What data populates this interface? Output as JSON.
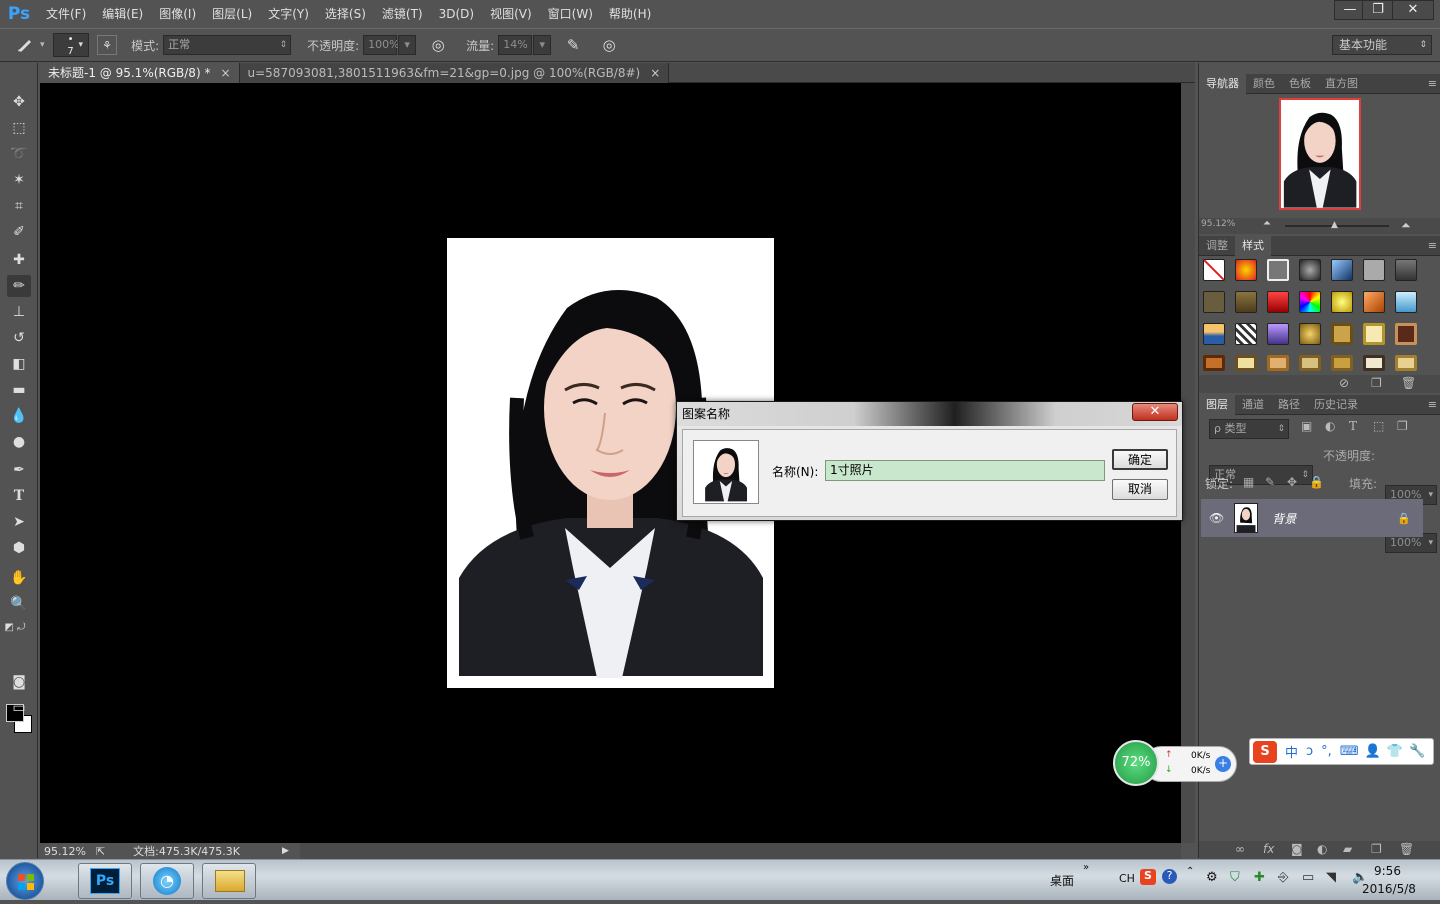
{
  "app": {
    "logo": "Ps"
  },
  "menu": [
    "文件(F)",
    "编辑(E)",
    "图像(I)",
    "图层(L)",
    "文字(Y)",
    "选择(S)",
    "滤镜(T)",
    "3D(D)",
    "视图(V)",
    "窗口(W)",
    "帮助(H)"
  ],
  "window_controls": {
    "minimize": "—",
    "restore": "❐",
    "close": "✕"
  },
  "options": {
    "brush_size": "7",
    "mode_label": "模式:",
    "mode_value": "正常",
    "opacity_label": "不透明度:",
    "opacity_value": "100%",
    "flow_label": "流量:",
    "flow_value": "14%",
    "workspace": "基本功能"
  },
  "tabs": [
    {
      "label": "未标题-1 @ 95.1%(RGB/8) *",
      "close": "×"
    },
    {
      "label": "u=587093081,3801511963&fm=21&gp=0.jpg @ 100%(RGB/8#)",
      "close": "×"
    }
  ],
  "status": {
    "zoom": "95.12%",
    "doc": "文档:475.3K/475.3K"
  },
  "navigator": {
    "tabs": [
      "导航器",
      "颜色",
      "色板",
      "直方图"
    ],
    "zoom": "95.12%"
  },
  "styles_panel": {
    "tabs": [
      "调整",
      "样式"
    ]
  },
  "layers_panel": {
    "tabs": [
      "图层",
      "通道",
      "路径",
      "历史记录"
    ],
    "filter": "ρ 类型",
    "blend": "正常",
    "opacity_label": "不透明度:",
    "opacity_value": "100%",
    "lock_label": "锁定:",
    "fill_label": "填充:",
    "fill_value": "100%",
    "layers": [
      {
        "name": "背景"
      }
    ]
  },
  "dialog": {
    "title": "图案名称",
    "close": "✕",
    "name_label": "名称(N):",
    "name_value": "1寸照片",
    "ok": "确定",
    "cancel": "取消"
  },
  "widget": {
    "percent": "72%",
    "up": "0K/s",
    "down": "0K/s"
  },
  "ime": {
    "items": [
      "中",
      "ↄ",
      "°,",
      "⌨",
      "👤",
      "👕",
      "🔧"
    ]
  },
  "taskbar": {
    "desktop": "桌面",
    "lang": "CH",
    "time": "9:56",
    "date": "2016/5/8"
  },
  "colors": {
    "ps_blue": "#3aa3ff",
    "ui_dark": "#535353",
    "canvas": "#000000",
    "dialog_close": "#c0301e",
    "name_input_bg": "#c9e7cc",
    "widget_green": "#2ec05a"
  }
}
